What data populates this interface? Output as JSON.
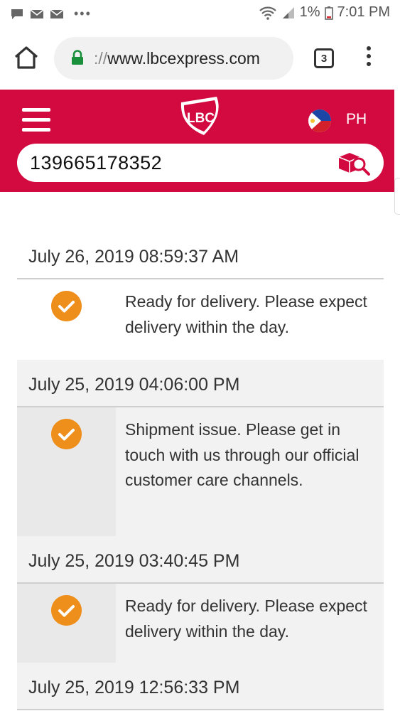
{
  "status_bar": {
    "battery": "1%",
    "time": "7:01 PM",
    "overflow": "•••"
  },
  "browser": {
    "url_prefix": "://",
    "url_host": "www.lbcexpress.com",
    "tab_count": "3"
  },
  "header": {
    "logo_text": "LBC",
    "country": "PH",
    "colors": {
      "brand": "#d20a40",
      "accent": "#ef8f1b"
    }
  },
  "search": {
    "value": "139665178352"
  },
  "timeline": [
    {
      "date": "July 26, 2019 08:59:37 AM",
      "status": "Ready for delivery. Please expect delivery within the day."
    },
    {
      "date": "July 25, 2019 04:06:00 PM",
      "status": "Shipment issue. Please get in touch with us through our official customer care channels."
    },
    {
      "date": "July 25, 2019 03:40:45 PM",
      "status": "Ready for delivery. Please expect delivery within the day."
    },
    {
      "date": "July 25, 2019 12:56:33 PM"
    }
  ]
}
